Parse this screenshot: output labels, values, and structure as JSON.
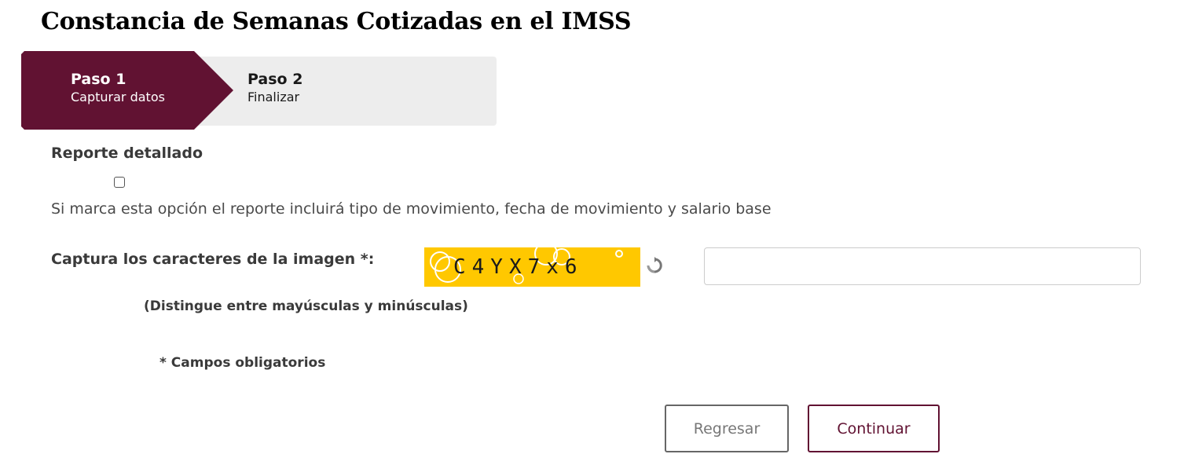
{
  "page": {
    "title": "Constancia de Semanas Cotizadas en el IMSS"
  },
  "stepper": {
    "steps": [
      {
        "number": "Paso 1",
        "description": "Capturar datos",
        "active": true
      },
      {
        "number": "Paso 2",
        "description": "Finalizar",
        "active": false
      }
    ],
    "active_color": "#611232",
    "inactive_color": "#ededed"
  },
  "detailed_report": {
    "label": "Reporte detallado",
    "checked": false,
    "help_text": "Si marca esta opción el reporte incluirá tipo de movimiento, fecha de movimiento y salario base"
  },
  "captcha": {
    "label": "Captura los caracteres de la imagen *:",
    "image_text": "C4YX7x6",
    "image_background": "#ffc800",
    "refresh_icon": "refresh-icon",
    "input_value": "",
    "input_placeholder": "",
    "case_note": "(Distingue entre mayúsculas y minúsculas)"
  },
  "required_note": "* Campos obligatorios",
  "buttons": {
    "back_label": "Regresar",
    "continue_label": "Continuar"
  }
}
